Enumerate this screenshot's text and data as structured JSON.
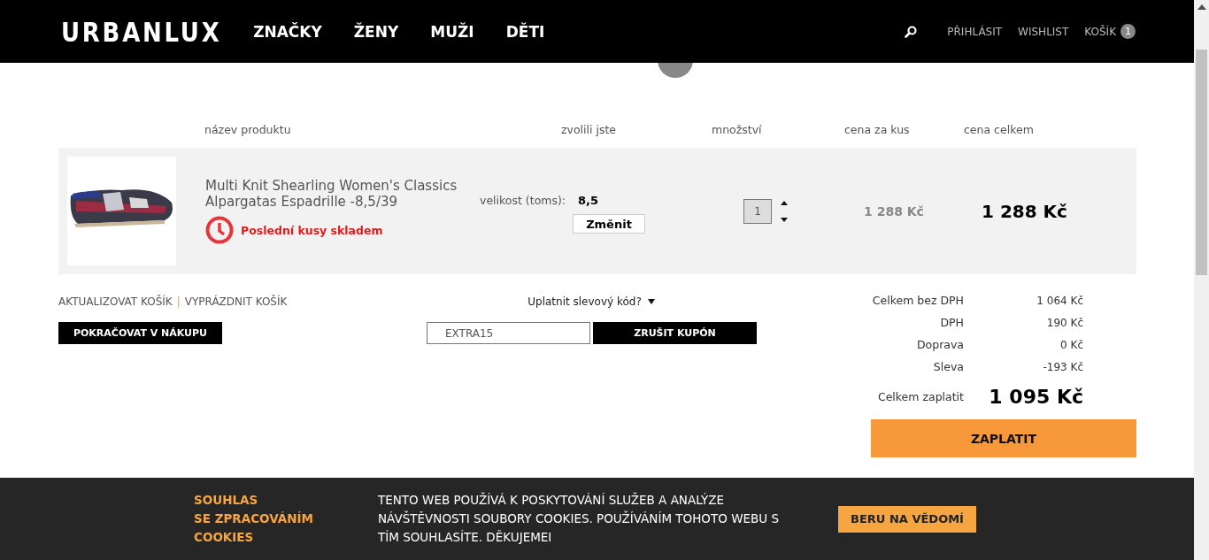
{
  "header": {
    "logo": "URBANLUX",
    "nav": [
      {
        "label": "ZNAČKY"
      },
      {
        "label": "ŽENY"
      },
      {
        "label": "MUŽI"
      },
      {
        "label": "DĚTI"
      }
    ],
    "login": "PŘIHLÁSIT",
    "wishlist": "WISHLIST",
    "cart": "KOŠÍK",
    "cart_count": "1"
  },
  "table": {
    "columns": [
      "název produktu",
      "zvolili jste",
      "množství",
      "cena za kus",
      "cena celkem"
    ],
    "rows": [
      {
        "name": "Multi Knit Shearling Women's Classics Alpargatas Espadrille -8,5/39",
        "stock": "Poslední kusy skladem",
        "size_label": "velikost (toms):",
        "size": "8,5",
        "change": "Změnit",
        "quantity": "1",
        "unit_price": "1 288 Kč",
        "total": "1 288 Kč"
      }
    ]
  },
  "cart_actions": {
    "update": "AKTUALIZOVAT KOŠÍK",
    "separator": "|",
    "empty": "VYPRÁZDNIT KOŠÍK",
    "continue": "POKRAČOVAT V NÁKUPU"
  },
  "coupon": {
    "toggle": "Uplatnit slevový kód?",
    "value": "EXTRA15",
    "cancel": "ZRUŠIT KUPÓN"
  },
  "summary": {
    "lines": [
      {
        "label": "Celkem bez DPH",
        "value": "1 064 Kč"
      },
      {
        "label": "DPH",
        "value": "190 Kč"
      },
      {
        "label": "Doprava",
        "value": "0 Kč"
      },
      {
        "label": "Sleva",
        "value": "-193 Kč"
      }
    ],
    "total_label": "Celkem zaplatit",
    "total": "1 095 Kč",
    "pay": "ZAPLATIT"
  },
  "cookie_bar": {
    "title": [
      "SOUHLAS",
      "SE ZPRACOVÁNÍM",
      "COOKIES"
    ],
    "text": "TENTO WEB POUŽÍVÁ K POSKYTOVÁNÍ SLUŽEB A ANALÝZE NÁVŠTĚVNOSTI SOUBORY COOKIES. POUŽÍVÁNÍM TOHOTO WEBU S TÍM SOUHLASÍTE. DĚKUJEMEI",
    "accept": "BERU NA VĚDOMÍ"
  }
}
